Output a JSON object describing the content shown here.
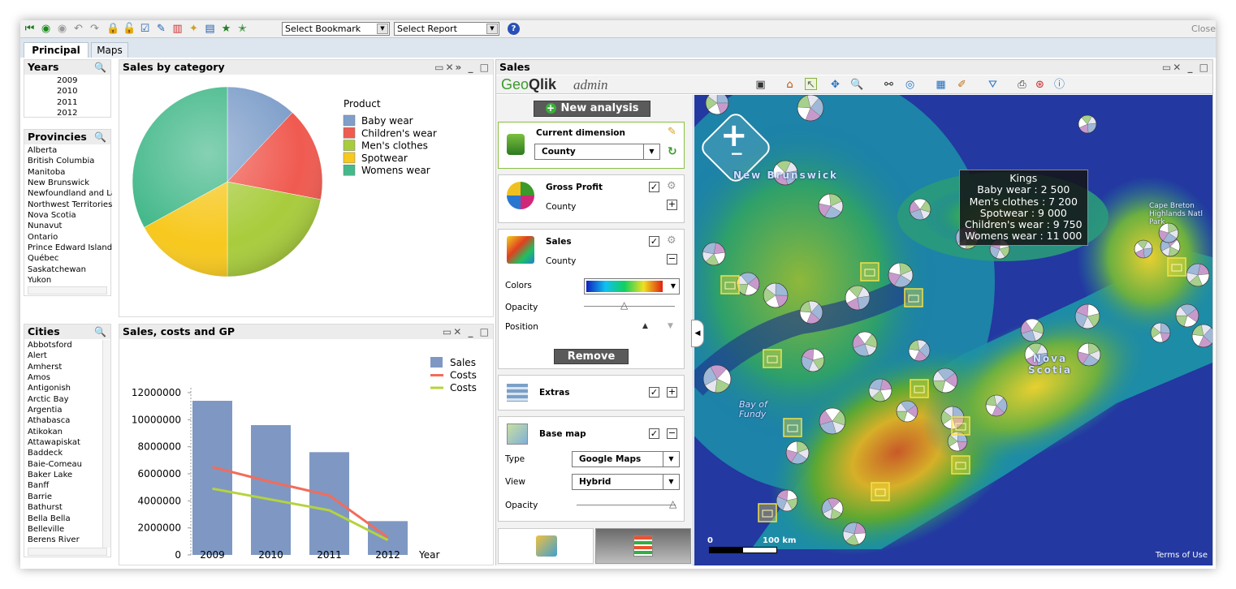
{
  "toolbar": {
    "select_bookmark": "Select Bookmark",
    "select_report": "Select Report",
    "close_label": "Close"
  },
  "tabs": [
    {
      "label": "Principal",
      "active": true
    },
    {
      "label": "Maps",
      "active": false
    }
  ],
  "years": {
    "title": "Years",
    "items": [
      "2009",
      "2010",
      "2011",
      "2012"
    ]
  },
  "provinces": {
    "title": "Provincies",
    "items": [
      "Alberta",
      "British Columbia",
      "Manitoba",
      "New Brunswick",
      "Newfoundland and La",
      "Northwest Territories",
      "Nova Scotia",
      "Nunavut",
      "Ontario",
      "Prince Edward Island",
      "Québec",
      "Saskatchewan",
      "Yukon"
    ]
  },
  "cities": {
    "title": "Cities",
    "items": [
      "Abbotsford",
      "Alert",
      "Amherst",
      "Amos",
      "Antigonish",
      "Arctic Bay",
      "Argentia",
      "Athabasca",
      "Atikokan",
      "Attawapiskat",
      "Baddeck",
      "Baie-Comeau",
      "Baker Lake",
      "Banff",
      "Barrie",
      "Bathurst",
      "Bella Bella",
      "Belleville",
      "Berens River"
    ]
  },
  "pie_panel": {
    "title": "Sales by category"
  },
  "bar_panel": {
    "title": "Sales, costs and GP"
  },
  "chart_data": [
    {
      "type": "pie",
      "legend_title": "Product",
      "categories": [
        "Baby wear",
        "Children's wear",
        "Men's clothes",
        "Spotwear",
        "Womens wear"
      ],
      "values": [
        12,
        16,
        22,
        17,
        33
      ],
      "colors": [
        "#7f9fca",
        "#f05a50",
        "#a8cc3c",
        "#f7c81d",
        "#45b98b"
      ],
      "legend_position": "right"
    },
    {
      "type": "bar",
      "categories": [
        "2009",
        "2010",
        "2011",
        "2012"
      ],
      "xlabel": "Year",
      "ylim": [
        0,
        12000000
      ],
      "yticks": [
        "0",
        "2000000",
        "4000000",
        "6000000",
        "8000000",
        "10000000",
        "12000000"
      ],
      "series": [
        {
          "name": "Sales",
          "kind": "bar",
          "color": "#7e98c3",
          "values": [
            11400000,
            9600000,
            7600000,
            2500000
          ]
        },
        {
          "name": "Costs",
          "kind": "line",
          "color": "#f26c5b",
          "values": [
            6500000,
            5400000,
            4400000,
            1300000
          ]
        },
        {
          "name": "Costs",
          "kind": "line",
          "color": "#b5d33d",
          "values": [
            4900000,
            4100000,
            3300000,
            1100000
          ]
        }
      ],
      "legend_position": "top-right"
    }
  ],
  "sales_panel": {
    "title": "Sales"
  },
  "geoqlik": {
    "logo_geo": "Geo",
    "logo_qlik": "Qlik",
    "logo_admin": "admin",
    "new_analysis": "New analysis",
    "current_dimension": {
      "title": "Current dimension",
      "value": "County"
    },
    "gross_profit": {
      "title": "Gross Profit",
      "sub": "County"
    },
    "sales": {
      "title": "Sales",
      "sub": "County",
      "colors_label": "Colors",
      "opacity_label": "Opacity",
      "position_label": "Position",
      "remove": "Remove"
    },
    "extras": {
      "title": "Extras"
    },
    "base_map": {
      "title": "Base map",
      "type_label": "Type",
      "type_value": "Google Maps",
      "view_label": "View",
      "view_value": "Hybrid",
      "opacity_label": "Opacity"
    }
  },
  "map": {
    "labels": {
      "new_brunswick": "New Brunswick",
      "nova_scotia": "Nova Scotia",
      "bay_of_fundy": "Bay of Fundy",
      "cape_breton": "Cape Breton Highlands Natl Park"
    },
    "tooltip": {
      "title": "Kings",
      "lines": [
        "Baby wear : 2 500",
        "Men's clothes : 7 200",
        "Spotwear : 9 000",
        "Children's wear : 9 750",
        "Womens wear : 11 000"
      ]
    },
    "scale_label": "100 km",
    "scale_zero": "0",
    "terms": "Terms of Use"
  }
}
